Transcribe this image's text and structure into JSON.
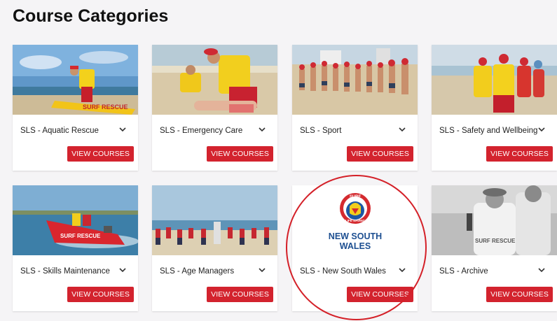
{
  "page": {
    "title": "Course Categories"
  },
  "colors": {
    "accent": "#d3232e",
    "highlight": "#d42028"
  },
  "categories": [
    {
      "label": "SLS - Aquatic Rescue",
      "button": "VIEW COURSES",
      "image": "aquatic-rescue-photo"
    },
    {
      "label": "SLS - Emergency Care",
      "button": "VIEW COURSES",
      "image": "emergency-care-photo"
    },
    {
      "label": "SLS - Sport",
      "button": "VIEW COURSES",
      "image": "sport-photo"
    },
    {
      "label": "SLS - Safety and Wellbeing",
      "button": "VIEW COURSES",
      "image": "safety-wellbeing-photo"
    },
    {
      "label": "SLS - Skills Maintenance",
      "button": "VIEW COURSES",
      "image": "skills-maintenance-photo"
    },
    {
      "label": "SLS - Age Managers",
      "button": "VIEW COURSES",
      "image": "age-managers-photo"
    },
    {
      "label": "SLS - New South Wales",
      "button": "VIEW COURSES",
      "image": "nsw-logo"
    },
    {
      "label": "SLS - Archive",
      "button": "VIEW COURSES",
      "image": "archive-photo"
    }
  ],
  "nsw_logo": {
    "badge_top": "SURF",
    "badge_ring": "LIFE SAVING",
    "line1": "NEW SOUTH",
    "line2": "WALES"
  },
  "thumb_text": {
    "rescue_board": "SURF RESCUE",
    "rescue_boat": "SURF RESCUE",
    "archive_shirt": "SURF RESCUE"
  }
}
